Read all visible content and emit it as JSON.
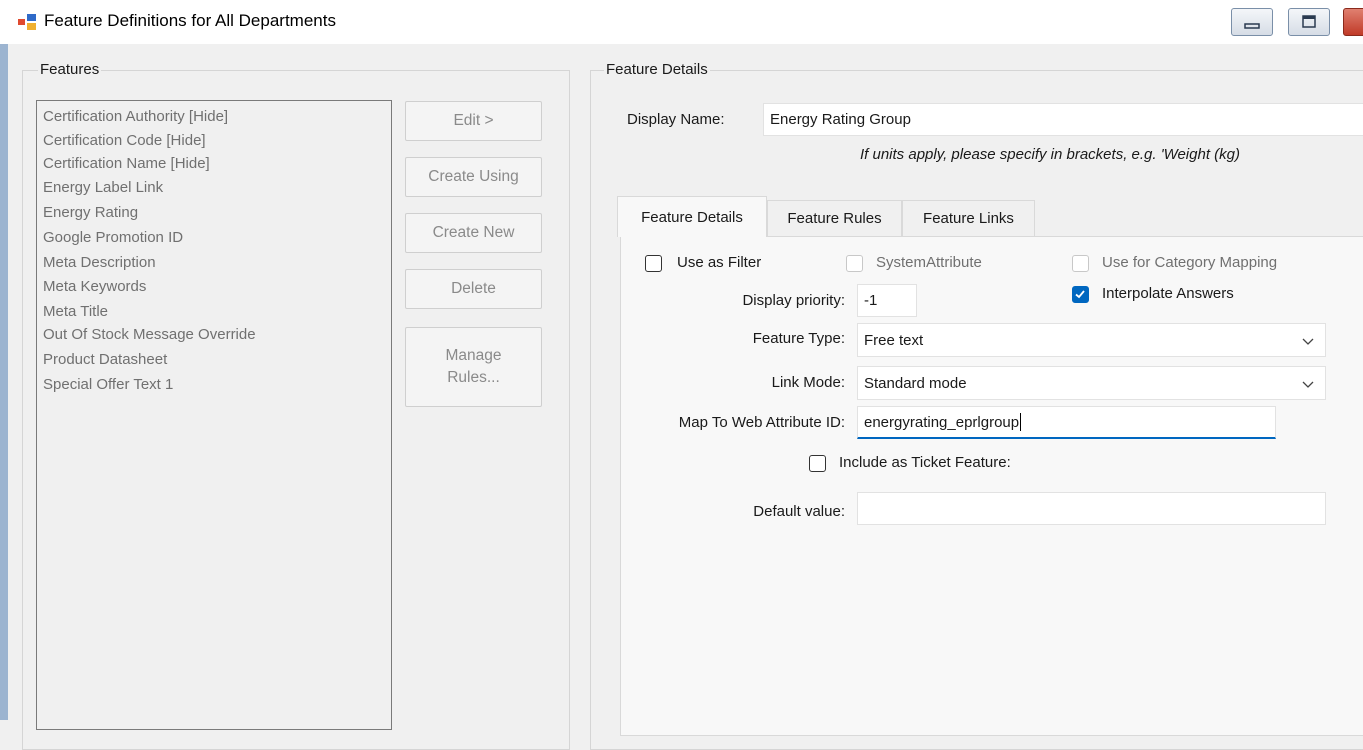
{
  "window": {
    "title": "Feature Definitions for All Departments"
  },
  "features_group": {
    "title": "Features",
    "items": [
      "Certification Authority [Hide]",
      "Certification Code [Hide]",
      "Certification Name [Hide]",
      "Energy Label Link",
      "Energy Rating",
      "Google Promotion ID",
      "Meta Description",
      "Meta Keywords",
      "Meta Title",
      "Out Of Stock Message Override",
      "Product Datasheet",
      "Special Offer Text 1"
    ]
  },
  "buttons": {
    "edit": "Edit >",
    "create_using": "Create Using",
    "create_new": "Create New",
    "delete": "Delete",
    "manage_rules": "Manage Rules..."
  },
  "details": {
    "group_title": "Feature Details",
    "display_name_label": "Display Name:",
    "display_name_value": "Energy Rating Group",
    "hint": "If units apply, please specify in brackets, e.g. 'Weight (kg)",
    "tabs": [
      "Feature Details",
      "Feature Rules",
      "Feature Links"
    ],
    "active_tab": "Feature Details",
    "use_as_filter": {
      "label": "Use as Filter",
      "checked": false
    },
    "system_attribute": {
      "label": "SystemAttribute",
      "checked": false,
      "enabled": false
    },
    "use_for_category_mapping": {
      "label": "Use for Category Mapping",
      "checked": false,
      "enabled": false
    },
    "interpolate_answers": {
      "label": "Interpolate Answers",
      "checked": true
    },
    "display_priority": {
      "label": "Display priority:",
      "value": "-1"
    },
    "feature_type": {
      "label": "Feature Type:",
      "value": "Free text"
    },
    "link_mode": {
      "label": "Link Mode:",
      "value": "Standard mode"
    },
    "map_to_web_attribute": {
      "label": "Map To Web Attribute ID:",
      "value": "energyrating_eprlgroup"
    },
    "include_as_ticket_feature": {
      "label": "Include as Ticket Feature:",
      "checked": false
    },
    "default_value": {
      "label": "Default value:",
      "value": ""
    }
  },
  "colors": {
    "accent": "#0067c0",
    "disabled_text": "#707070"
  }
}
